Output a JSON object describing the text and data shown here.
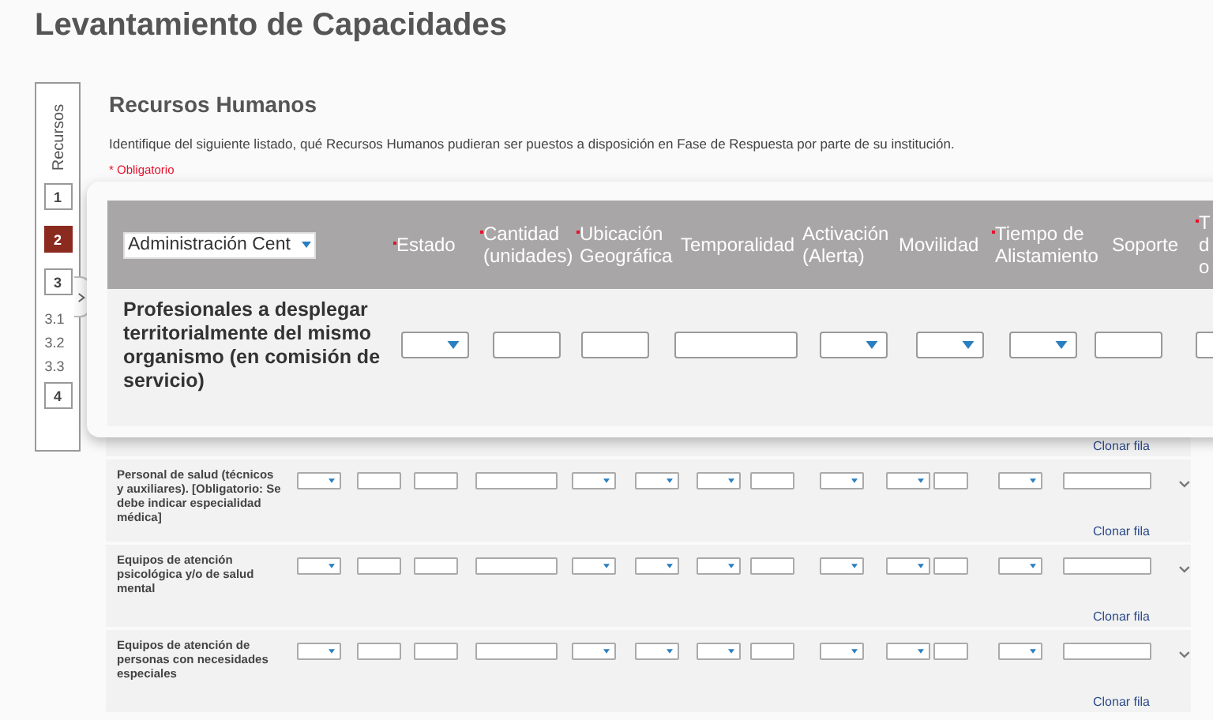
{
  "page_title": "Levantamiento de Capacidades",
  "sidebar": {
    "label": "Recursos",
    "steps": [
      {
        "label": "1",
        "kind": "box",
        "selected": false
      },
      {
        "label": "2",
        "kind": "box",
        "selected": true
      },
      {
        "label": "3",
        "kind": "box",
        "selected": false
      },
      {
        "label": "3.1",
        "kind": "sub",
        "selected": false
      },
      {
        "label": "3.2",
        "kind": "sub",
        "selected": false
      },
      {
        "label": "3.3",
        "kind": "sub",
        "selected": false
      },
      {
        "label": "4",
        "kind": "box",
        "selected": false
      }
    ]
  },
  "section": {
    "title": "Recursos Humanos",
    "description": "Identifique del siguiente listado, qué Recursos Humanos pudieran ser puestos a disposición en Fase de Respuesta por parte de su institución.",
    "required_note": "* Obligatorio"
  },
  "table": {
    "top_link": "Clonar fila",
    "rows": [
      {
        "label": "Personal de salud (técnicos y auxiliares). [Obligatorio: Se debe indicar especialidad médica]",
        "cells": [
          {
            "kind": "select"
          },
          {
            "kind": "input"
          },
          {
            "kind": "input"
          },
          {
            "kind": "wide"
          },
          {
            "kind": "select"
          },
          {
            "kind": "select"
          },
          {
            "kind": "select"
          },
          {
            "kind": "input"
          },
          {
            "kind": "select"
          },
          {
            "kind": "select"
          },
          {
            "kind": "narrow"
          },
          {
            "kind": "select"
          },
          {
            "kind": "long"
          }
        ],
        "link": "Clonar fila"
      },
      {
        "label": "Equipos de atención psicológica y/o de salud mental",
        "cells": [
          {
            "kind": "select"
          },
          {
            "kind": "input"
          },
          {
            "kind": "input"
          },
          {
            "kind": "wide"
          },
          {
            "kind": "select"
          },
          {
            "kind": "select"
          },
          {
            "kind": "select"
          },
          {
            "kind": "input"
          },
          {
            "kind": "select"
          },
          {
            "kind": "select"
          },
          {
            "kind": "narrow"
          },
          {
            "kind": "select"
          },
          {
            "kind": "long"
          }
        ],
        "link": "Clonar fila"
      },
      {
        "label": "Equipos de atención de personas con necesidades especiales",
        "cells": [
          {
            "kind": "select"
          },
          {
            "kind": "input"
          },
          {
            "kind": "input"
          },
          {
            "kind": "wide"
          },
          {
            "kind": "select"
          },
          {
            "kind": "select"
          },
          {
            "kind": "select"
          },
          {
            "kind": "input"
          },
          {
            "kind": "select"
          },
          {
            "kind": "select"
          },
          {
            "kind": "narrow"
          },
          {
            "kind": "select"
          },
          {
            "kind": "long"
          }
        ],
        "link": "Clonar fila"
      }
    ]
  },
  "zoom_card": {
    "filter_value": "Administración Cent",
    "columns": [
      {
        "label": "Estado",
        "required": true
      },
      {
        "label": "Cantidad (unidades)",
        "required": true
      },
      {
        "label": "Ubicación Geográfica",
        "required": true
      },
      {
        "label": "Temporalidad",
        "required": false
      },
      {
        "label": "Activación (Alerta)",
        "required": false
      },
      {
        "label": "Movilidad",
        "required": false
      },
      {
        "label": "Tiempo de Alistamiento",
        "required": true
      },
      {
        "label": "Soporte",
        "required": false
      },
      {
        "label": "T d o",
        "required": true
      }
    ],
    "row": {
      "label": "Profesionales a desplegar territorialmente del mismo organismo (en comisión de servicio)",
      "cells": [
        {
          "kind": "select"
        },
        {
          "kind": "input"
        },
        {
          "kind": "input"
        },
        {
          "kind": "wide"
        },
        {
          "kind": "select"
        },
        {
          "kind": "select"
        },
        {
          "kind": "select"
        },
        {
          "kind": "input"
        },
        {
          "kind": "input"
        }
      ]
    }
  }
}
